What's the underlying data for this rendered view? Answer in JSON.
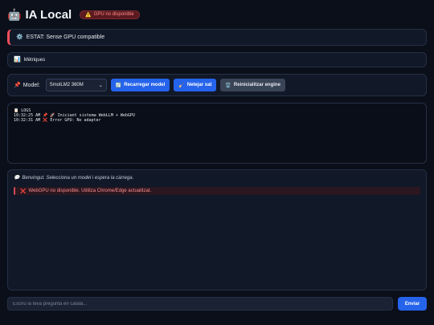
{
  "header": {
    "robot_icon": "🤖",
    "title": "IA Local",
    "badge_icon": "⚠️",
    "badge_text": "GPU no disponible"
  },
  "status": {
    "icon": "⚙️",
    "text": "ESTAT: Sense GPU compatible"
  },
  "metrics": {
    "icon": "📊",
    "label": "Mètriques"
  },
  "controls": {
    "pin_icon": "📌",
    "model_label": "Model:",
    "selected_model": "SmolLM2 360M",
    "reload_icon": "🔄",
    "reload_label": "Recarregar model",
    "clean_icon": "🧹",
    "clean_label": "Netejar xat",
    "reset_icon": "🗑️",
    "reset_label": "Reinicialitzar engine"
  },
  "logs": {
    "title_icon": "📋",
    "title": "LOGS",
    "lines": [
      "10:32:25 AM 📌 🚀 Iniciant sistema WebLLM + WebGPU",
      "10:32:31 AM ❌ Error GPU: No adapter"
    ]
  },
  "chat": {
    "welcome_icon": "💬",
    "welcome": "Benvingut. Selecciona un model i espera la càrrega.",
    "error_icon": "❌",
    "error": "WebGPU no disponible. Utilitza Chrome/Edge actualitzat."
  },
  "composer": {
    "placeholder": "Escriu la teva pregunta en català...",
    "send_label": "Enviar"
  },
  "colors": {
    "background": "#0b0f1a",
    "panel": "#111827",
    "accent": "#2563eb",
    "error": "#ef4f5a"
  }
}
